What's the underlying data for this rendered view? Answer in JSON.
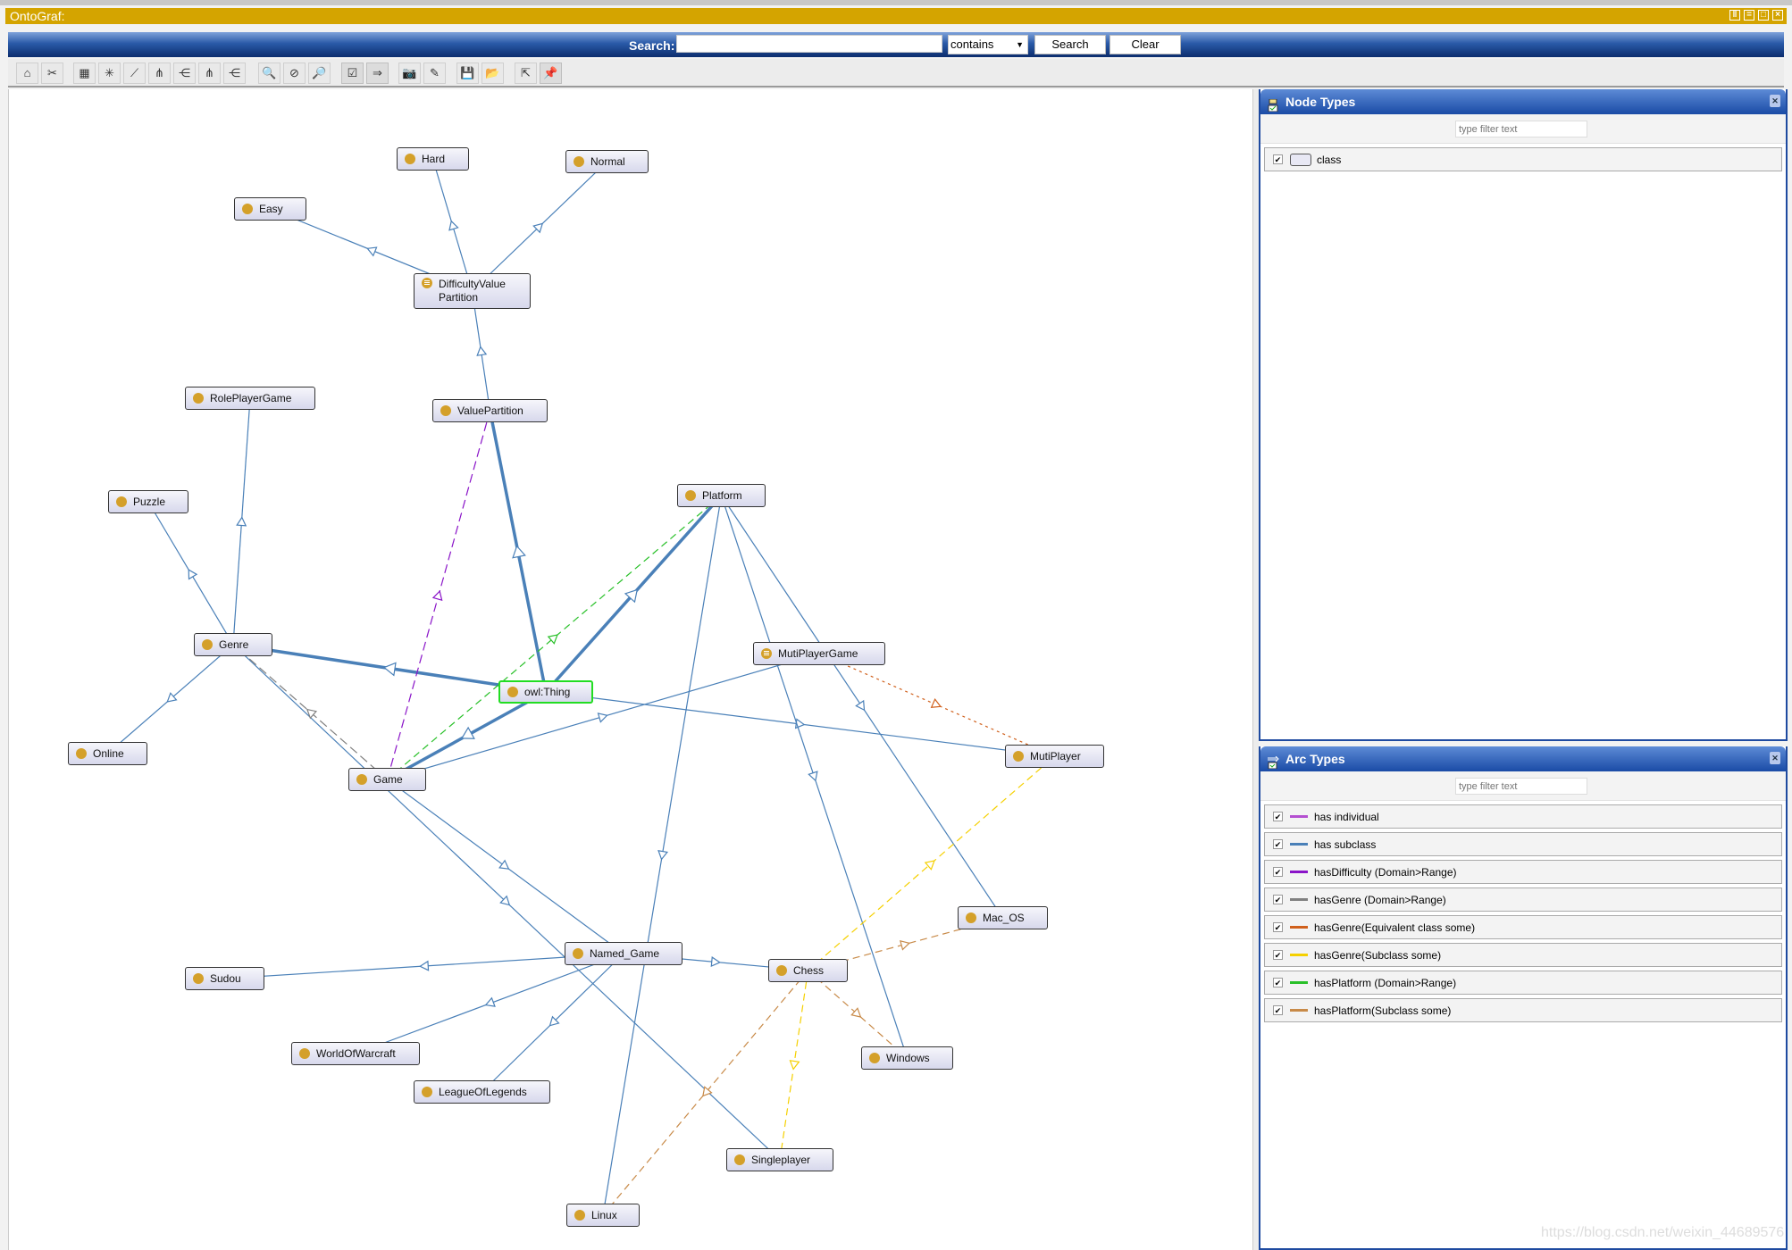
{
  "window": {
    "title": "OntoGraf:",
    "controls": [
      "tile-vertical",
      "tile-horizontal",
      "maximize",
      "close"
    ]
  },
  "search": {
    "label": "Search:",
    "value": "",
    "mode": "contains",
    "search_button": "Search",
    "clear_button": "Clear"
  },
  "toolbar": {
    "buttons": [
      {
        "icon": "home-icon",
        "glyph": "⌂"
      },
      {
        "icon": "remove-graph-icon",
        "glyph": "✂"
      },
      {
        "icon": "grid-layout-icon",
        "glyph": "▦"
      },
      {
        "icon": "radial-layout-icon",
        "glyph": "✳"
      },
      {
        "icon": "spring-layout-icon",
        "glyph": "⟋"
      },
      {
        "icon": "vertical-tree-layout-icon",
        "glyph": "⋔"
      },
      {
        "icon": "horizontal-tree-layout-icon",
        "glyph": "⋲"
      },
      {
        "icon": "vertical-directed-layout-icon",
        "glyph": "⋔"
      },
      {
        "icon": "horizontal-directed-layout-icon",
        "glyph": "⋲"
      },
      {
        "icon": "zoom-in-icon",
        "glyph": "🔍"
      },
      {
        "icon": "zoom-reset-icon",
        "glyph": "⊘"
      },
      {
        "icon": "zoom-out-icon",
        "glyph": "🔎"
      },
      {
        "icon": "node-types-toggle-icon",
        "glyph": "☑"
      },
      {
        "icon": "arc-types-toggle-icon",
        "glyph": "⇒"
      },
      {
        "icon": "camera-icon",
        "glyph": "📷"
      },
      {
        "icon": "edit-note-icon",
        "glyph": "✎"
      },
      {
        "icon": "save-icon",
        "glyph": "💾"
      },
      {
        "icon": "open-folder-icon",
        "glyph": "📂"
      },
      {
        "icon": "export-icon",
        "glyph": "⇱"
      },
      {
        "icon": "pin-icon",
        "glyph": "📌"
      }
    ]
  },
  "graph": {
    "nodes": [
      {
        "id": "Hard",
        "label": "Hard"
      },
      {
        "id": "Normal",
        "label": "Normal"
      },
      {
        "id": "Easy",
        "label": "Easy"
      },
      {
        "id": "DifficultyValuePartition",
        "label": "DifficultyValue",
        "label2": "Partition",
        "equivalent": true
      },
      {
        "id": "RolePlayerGame",
        "label": "RolePlayerGame"
      },
      {
        "id": "ValuePartition",
        "label": "ValuePartition"
      },
      {
        "id": "Puzzle",
        "label": "Puzzle"
      },
      {
        "id": "Platform",
        "label": "Platform"
      },
      {
        "id": "Genre",
        "label": "Genre"
      },
      {
        "id": "MutiPlayerGame",
        "label": "MutiPlayerGame",
        "equivalent": true
      },
      {
        "id": "owlThing",
        "label": "owl:Thing",
        "selected": true
      },
      {
        "id": "Online",
        "label": "Online"
      },
      {
        "id": "MutiPlayer",
        "label": "MutiPlayer"
      },
      {
        "id": "Game",
        "label": "Game"
      },
      {
        "id": "Mac_OS",
        "label": "Mac_OS"
      },
      {
        "id": "Named_Game",
        "label": "Named_Game"
      },
      {
        "id": "Chess",
        "label": "Chess"
      },
      {
        "id": "Sudou",
        "label": "Sudou"
      },
      {
        "id": "WorldOfWarcraft",
        "label": "WorldOfWarcraft"
      },
      {
        "id": "Windows",
        "label": "Windows"
      },
      {
        "id": "LeagueOfLegends",
        "label": "LeagueOfLegends"
      },
      {
        "id": "Singleplayer",
        "label": "Singleplayer"
      },
      {
        "id": "Linux",
        "label": "Linux"
      }
    ],
    "edges": [
      {
        "from": "DifficultyValuePartition",
        "to": "Hard",
        "type": "has subclass"
      },
      {
        "from": "DifficultyValuePartition",
        "to": "Normal",
        "type": "has subclass"
      },
      {
        "from": "DifficultyValuePartition",
        "to": "Easy",
        "type": "has subclass"
      },
      {
        "from": "ValuePartition",
        "to": "DifficultyValuePartition",
        "type": "has subclass"
      },
      {
        "from": "owlThing",
        "to": "ValuePartition",
        "type": "has subclass",
        "thick": true
      },
      {
        "from": "owlThing",
        "to": "Platform",
        "type": "has subclass",
        "thick": true
      },
      {
        "from": "owlThing",
        "to": "Genre",
        "type": "has subclass",
        "thick": true
      },
      {
        "from": "owlThing",
        "to": "Game",
        "type": "has subclass",
        "thick": true
      },
      {
        "from": "Genre",
        "to": "RolePlayerGame",
        "type": "has subclass"
      },
      {
        "from": "Genre",
        "to": "Puzzle",
        "type": "has subclass"
      },
      {
        "from": "Genre",
        "to": "Online",
        "type": "has subclass"
      },
      {
        "from": "Genre",
        "to": "Singleplayer",
        "type": "has subclass"
      },
      {
        "from": "owlThing",
        "to": "MutiPlayer",
        "type": "has subclass"
      },
      {
        "from": "Game",
        "to": "MutiPlayerGame",
        "type": "has subclass"
      },
      {
        "from": "Game",
        "to": "Named_Game",
        "type": "has subclass"
      },
      {
        "from": "Platform",
        "to": "Linux",
        "type": "has subclass"
      },
      {
        "from": "Platform",
        "to": "Windows",
        "type": "has subclass"
      },
      {
        "from": "Platform",
        "to": "Mac_OS",
        "type": "has subclass"
      },
      {
        "from": "Named_Game",
        "to": "Chess",
        "type": "has subclass"
      },
      {
        "from": "Named_Game",
        "to": "Sudou",
        "type": "has subclass"
      },
      {
        "from": "Named_Game",
        "to": "WorldOfWarcraft",
        "type": "has subclass"
      },
      {
        "from": "Named_Game",
        "to": "LeagueOfLegends",
        "type": "has subclass"
      },
      {
        "from": "Game",
        "to": "ValuePartition",
        "type": "hasDifficulty (Domain>Range)"
      },
      {
        "from": "Game",
        "to": "Platform",
        "type": "hasPlatform (Domain>Range)"
      },
      {
        "from": "Game",
        "to": "Genre",
        "type": "hasGenre (Domain>Range)"
      },
      {
        "from": "MutiPlayerGame",
        "to": "MutiPlayer",
        "type": "hasGenre(Equivalent class some)"
      },
      {
        "from": "Chess",
        "to": "Singleplayer",
        "type": "hasGenre(Subclass some)"
      },
      {
        "from": "Chess",
        "to": "MutiPlayer",
        "type": "hasGenre(Subclass some)"
      },
      {
        "from": "Chess",
        "to": "Mac_OS",
        "type": "hasPlatform(Subclass some)"
      },
      {
        "from": "Chess",
        "to": "Windows",
        "type": "hasPlatform(Subclass some)"
      },
      {
        "from": "Chess",
        "to": "Linux",
        "type": "hasPlatform(Subclass some)"
      }
    ]
  },
  "node_types": {
    "title": "Node Types",
    "filter_placeholder": "type filter text",
    "items": [
      {
        "label": "class",
        "checked": true
      }
    ]
  },
  "arc_types": {
    "title": "Arc Types",
    "filter_placeholder": "type filter text",
    "items": [
      {
        "label": "has individual",
        "color": "#b44fd0",
        "checked": true
      },
      {
        "label": "has subclass",
        "color": "#4a80b8",
        "checked": true
      },
      {
        "label": "hasDifficulty (Domain>Range)",
        "color": "#8a14c8",
        "checked": true
      },
      {
        "label": "hasGenre (Domain>Range)",
        "color": "#808080",
        "checked": true
      },
      {
        "label": "hasGenre(Equivalent class some)",
        "color": "#d0601c",
        "checked": true
      },
      {
        "label": "hasGenre(Subclass some)",
        "color": "#f5d000",
        "checked": true
      },
      {
        "label": "hasPlatform (Domain>Range)",
        "color": "#28c028",
        "checked": true
      },
      {
        "label": "hasPlatform(Subclass some)",
        "color": "#c88a48",
        "checked": true
      }
    ]
  },
  "watermark": "https://blog.csdn.net/weixin_44689576"
}
